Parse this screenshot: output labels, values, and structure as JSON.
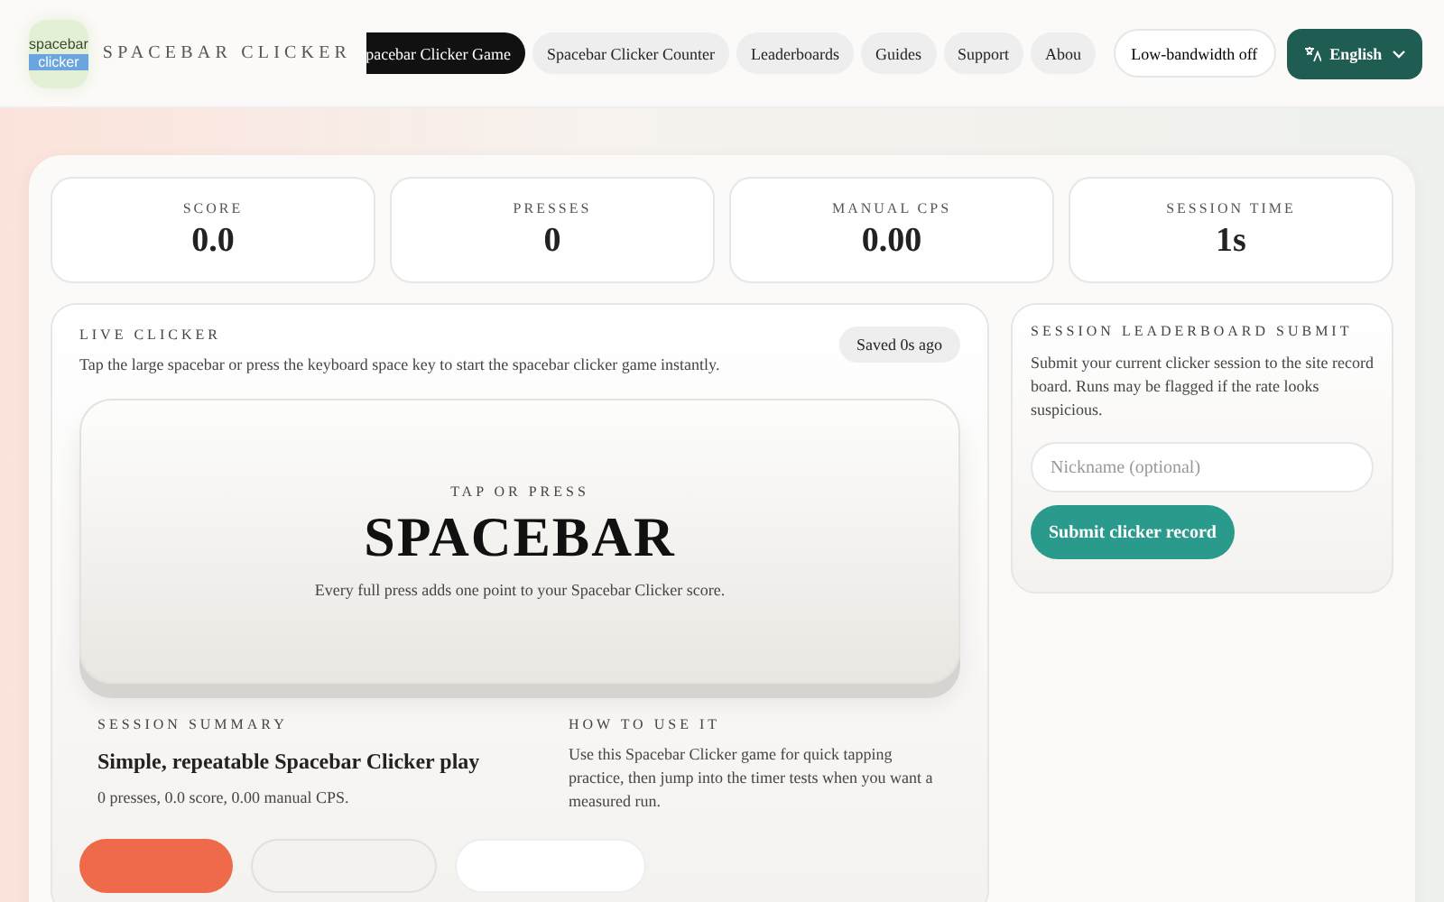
{
  "header": {
    "logo": {
      "top": "spacebar",
      "bottom": "clicker"
    },
    "brand": "SPACEBAR CLICKER",
    "nav": [
      {
        "label": "pacebar Clicker Game",
        "selected": true
      },
      {
        "label": "Spacebar Clicker Counter",
        "selected": false
      },
      {
        "label": "Leaderboards",
        "selected": false
      },
      {
        "label": "Guides",
        "selected": false
      },
      {
        "label": "Support",
        "selected": false
      },
      {
        "label": "Abou",
        "selected": false
      }
    ],
    "bandwidth_toggle": "Low-bandwidth off",
    "language": "English"
  },
  "stats": [
    {
      "label": "SCORE",
      "value": "0.0"
    },
    {
      "label": "PRESSES",
      "value": "0"
    },
    {
      "label": "MANUAL CPS",
      "value": "0.00"
    },
    {
      "label": "SESSION TIME",
      "value": "1s"
    }
  ],
  "live_clicker": {
    "title": "LIVE CLICKER",
    "description": "Tap the large spacebar or press the keyboard space key to start the spacebar clicker game instantly.",
    "saved_badge": "Saved 0s ago",
    "key": {
      "eyebrow": "TAP OR PRESS",
      "label": "SPACEBAR",
      "hint": "Every full press adds one point to your Spacebar Clicker score."
    },
    "summary": {
      "title": "SESSION SUMMARY",
      "heading": "Simple, repeatable Spacebar Clicker play",
      "text": "0 presses, 0.0 score, 0.00 manual CPS."
    },
    "how_to": {
      "title": "HOW TO USE IT",
      "text": "Use this Spacebar Clicker game for quick tapping practice, then jump into the timer tests when you want a measured run."
    },
    "actions": [
      {
        "kind": "primary"
      },
      {
        "kind": "outline"
      },
      {
        "kind": "plain"
      }
    ]
  },
  "leaderboard": {
    "title": "SESSION LEADERBOARD SUBMIT",
    "description": "Submit your current clicker session to the site record board. Runs may be flagged if the rate looks suspicious.",
    "nickname": {
      "placeholder": "Nickname (optional)"
    },
    "submit": "Submit clicker record"
  }
}
